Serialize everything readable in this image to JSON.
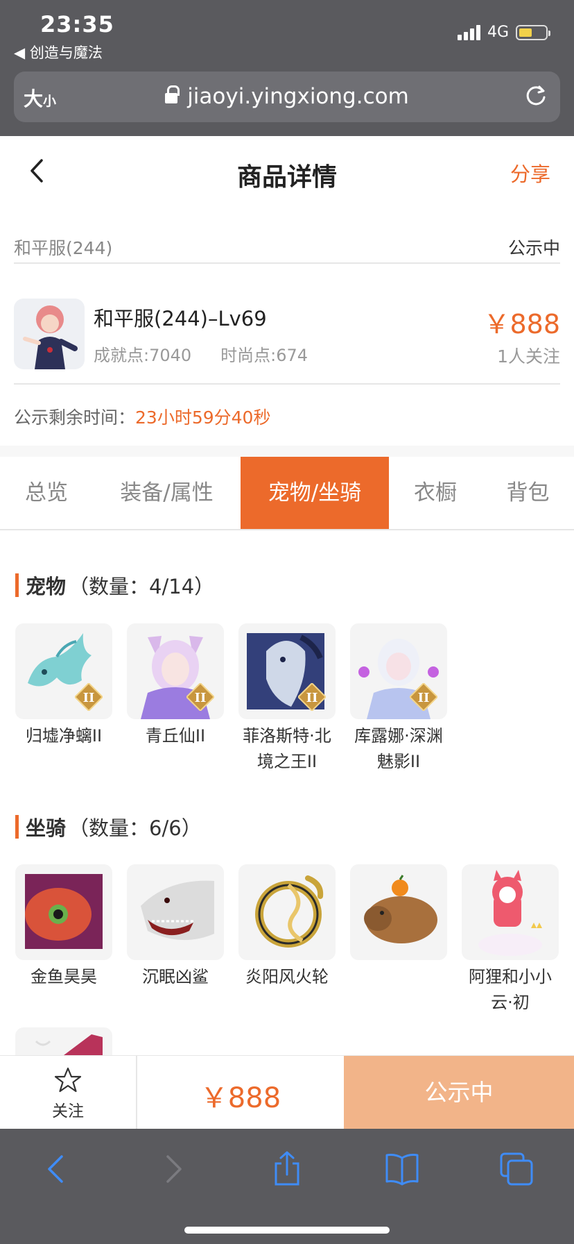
{
  "status_bar": {
    "time": "23:35",
    "back_app": "◀ 创造与魔法",
    "network": "4G"
  },
  "browser": {
    "textsize_big": "大",
    "textsize_small": "小",
    "url": "jiaoyi.yingxiong.com"
  },
  "header": {
    "title": "商品详情",
    "share": "分享"
  },
  "server_row": {
    "server": "和平服(244)",
    "status": "公示中"
  },
  "product": {
    "name": "和平服(244)–Lv69",
    "achievement": "成就点:7040",
    "fashion": "时尚点:674",
    "price": "￥888",
    "followers": "1人关注"
  },
  "timer": {
    "label": "公示剩余时间：",
    "value": "23小时59分40秒"
  },
  "tabs": [
    {
      "label": "总览"
    },
    {
      "label": "装备/属性"
    },
    {
      "label": "宠物/坐骑",
      "active": true
    },
    {
      "label": "衣橱"
    },
    {
      "label": "背包"
    }
  ],
  "pets": {
    "title": "宠物",
    "count": "（数量：4/14）",
    "items": [
      {
        "label": "归墟净螭II",
        "tier": "II"
      },
      {
        "label": "青丘仙II",
        "tier": "II"
      },
      {
        "label": "菲洛斯特·北境之王II",
        "tier": "II"
      },
      {
        "label": "库露娜·深渊魅影II",
        "tier": "II"
      }
    ]
  },
  "mounts": {
    "title": "坐骑",
    "count": "（数量：6/6）",
    "items": [
      {
        "label": "金鱼昊昊"
      },
      {
        "label": "沉眠凶鲨"
      },
      {
        "label": "炎阳风火轮"
      },
      {
        "label": ""
      },
      {
        "label": "阿狸和小小云·初"
      }
    ]
  },
  "action_bar": {
    "follow": "关注",
    "price": "￥888",
    "status": "公示中"
  },
  "colors": {
    "accent": "#ec6a2b",
    "accent_light": "#f2b489",
    "chrome": "#5a5a5e",
    "link_blue": "#3f8cf7"
  }
}
